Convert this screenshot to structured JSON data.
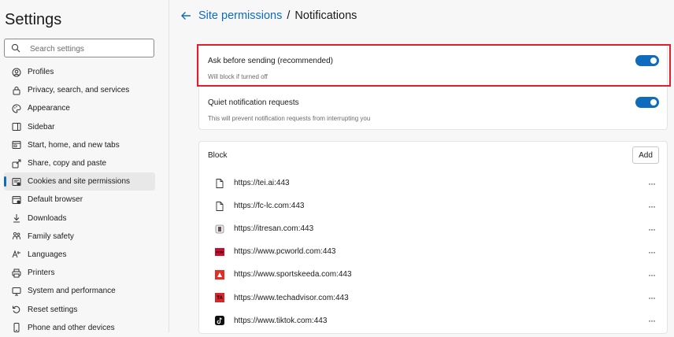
{
  "sidebar": {
    "title": "Settings",
    "search_placeholder": "Search settings",
    "items": [
      {
        "label": "Profiles",
        "icon": "profile-icon"
      },
      {
        "label": "Privacy, search, and services",
        "icon": "lock-icon"
      },
      {
        "label": "Appearance",
        "icon": "palette-icon"
      },
      {
        "label": "Sidebar",
        "icon": "sidebar-icon"
      },
      {
        "label": "Start, home, and new tabs",
        "icon": "home-icon"
      },
      {
        "label": "Share, copy and paste",
        "icon": "share-icon"
      },
      {
        "label": "Cookies and site permissions",
        "icon": "cookies-icon",
        "active": true
      },
      {
        "label": "Default browser",
        "icon": "browser-icon"
      },
      {
        "label": "Downloads",
        "icon": "download-icon"
      },
      {
        "label": "Family safety",
        "icon": "family-icon"
      },
      {
        "label": "Languages",
        "icon": "language-icon"
      },
      {
        "label": "Printers",
        "icon": "printer-icon"
      },
      {
        "label": "System and performance",
        "icon": "system-icon"
      },
      {
        "label": "Reset settings",
        "icon": "reset-icon"
      },
      {
        "label": "Phone and other devices",
        "icon": "phone-icon"
      }
    ]
  },
  "header": {
    "breadcrumb_link": "Site permissions",
    "separator": "/",
    "current": "Notifications"
  },
  "settings": {
    "ask": {
      "title": "Ask before sending (recommended)",
      "description": "Will block if turned off",
      "enabled": true
    },
    "quiet": {
      "title": "Quiet notification requests",
      "description": "This will prevent notification requests from interrupting you",
      "enabled": true
    }
  },
  "block": {
    "title": "Block",
    "add_label": "Add",
    "more_label": "···",
    "sites": [
      {
        "url": "https://tei.ai:443",
        "icon": "page-icon"
      },
      {
        "url": "https://fc-lc.com:443",
        "icon": "page-icon"
      },
      {
        "url": "https://itresan.com:443",
        "icon": "itresan-favicon"
      },
      {
        "url": "https://www.pcworld.com:443",
        "icon": "pcworld-favicon",
        "favicon_text": "PCW"
      },
      {
        "url": "https://www.sportskeeda.com:443",
        "icon": "sportskeeda-favicon"
      },
      {
        "url": "https://www.techadvisor.com:443",
        "icon": "techadvisor-favicon",
        "favicon_text": "TA"
      },
      {
        "url": "https://www.tiktok.com:443",
        "icon": "tiktok-favicon"
      }
    ]
  },
  "colors": {
    "accent": "#0f6cbd",
    "highlight": "#e0202c"
  }
}
